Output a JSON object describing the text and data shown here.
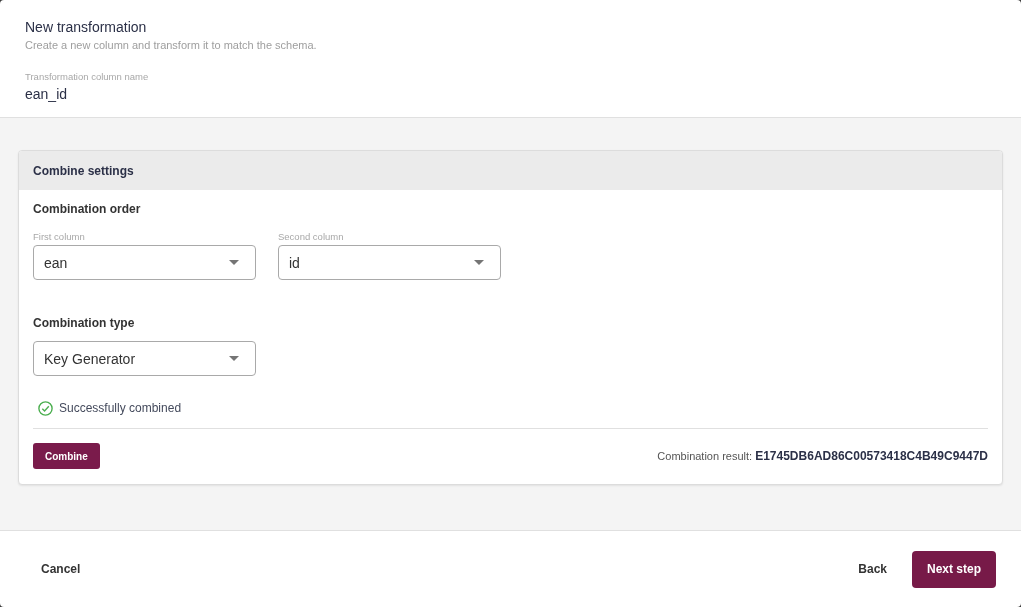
{
  "dialog": {
    "title": "New transformation",
    "subtitle": "Create a new column and transform it to match the schema.",
    "name_field": {
      "label": "Transformation column name",
      "value": "ean_id"
    }
  },
  "combine_settings": {
    "title": "Combine settings",
    "order_heading": "Combination order",
    "order_selects": [
      {
        "label": "First column",
        "value": "ean"
      },
      {
        "label": "Second column",
        "value": "id"
      }
    ],
    "type_heading": "Combination type",
    "type_select": {
      "value": "Key Generator"
    },
    "status": {
      "kind": "success",
      "text": "Successfully combined"
    },
    "combine_button": "Combine",
    "result": {
      "label": "Combination result:",
      "value": "E1745DB6AD86C00573418C4B49C9447D"
    }
  },
  "footer": {
    "cancel": "Cancel",
    "back": "Back",
    "next": "Next step"
  }
}
